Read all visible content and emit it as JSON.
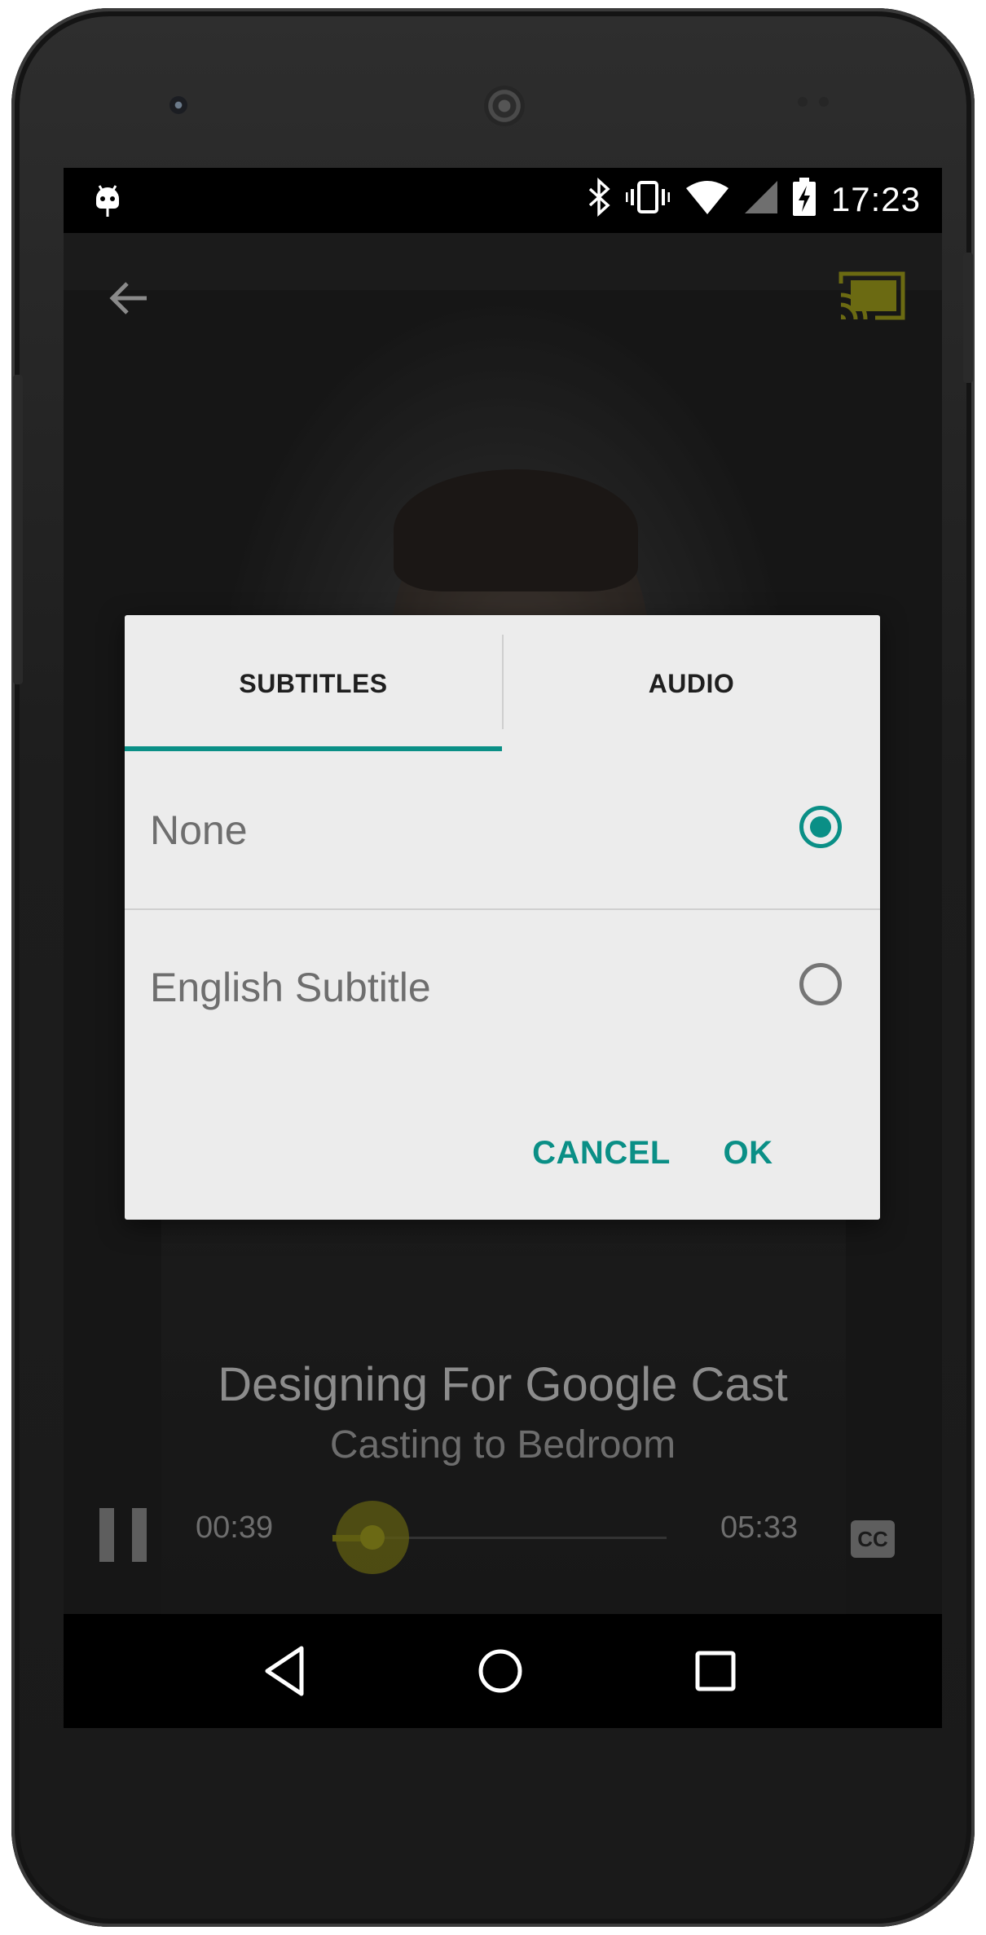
{
  "status_bar": {
    "time": "17:23",
    "icons": [
      "android-debug-icon",
      "bluetooth-icon",
      "vibrate-icon",
      "wifi-icon",
      "cell-signal-icon",
      "battery-charging-icon"
    ]
  },
  "app_bar": {
    "icons": [
      "back-arrow-icon",
      "cast-connected-icon"
    ],
    "cast_color": "#6b6a12"
  },
  "dialog": {
    "tabs": [
      {
        "label": "SUBTITLES",
        "selected": true
      },
      {
        "label": "AUDIO",
        "selected": false
      }
    ],
    "options": [
      {
        "label": "None",
        "checked": true
      },
      {
        "label": "English Subtitle",
        "checked": false
      }
    ],
    "cancel_label": "CANCEL",
    "ok_label": "OK",
    "accent_color": "#0a8f86"
  },
  "now_playing": {
    "title": "Designing For Google Cast",
    "subtitle": "Casting to Bedroom"
  },
  "player": {
    "elapsed": "00:39",
    "total": "05:33",
    "progress": 0.12,
    "cc_label": "CC",
    "seek_color": "#6b6914"
  },
  "nav_bar": {
    "icons": [
      "nav-back-icon",
      "nav-home-icon",
      "nav-recents-icon"
    ]
  }
}
